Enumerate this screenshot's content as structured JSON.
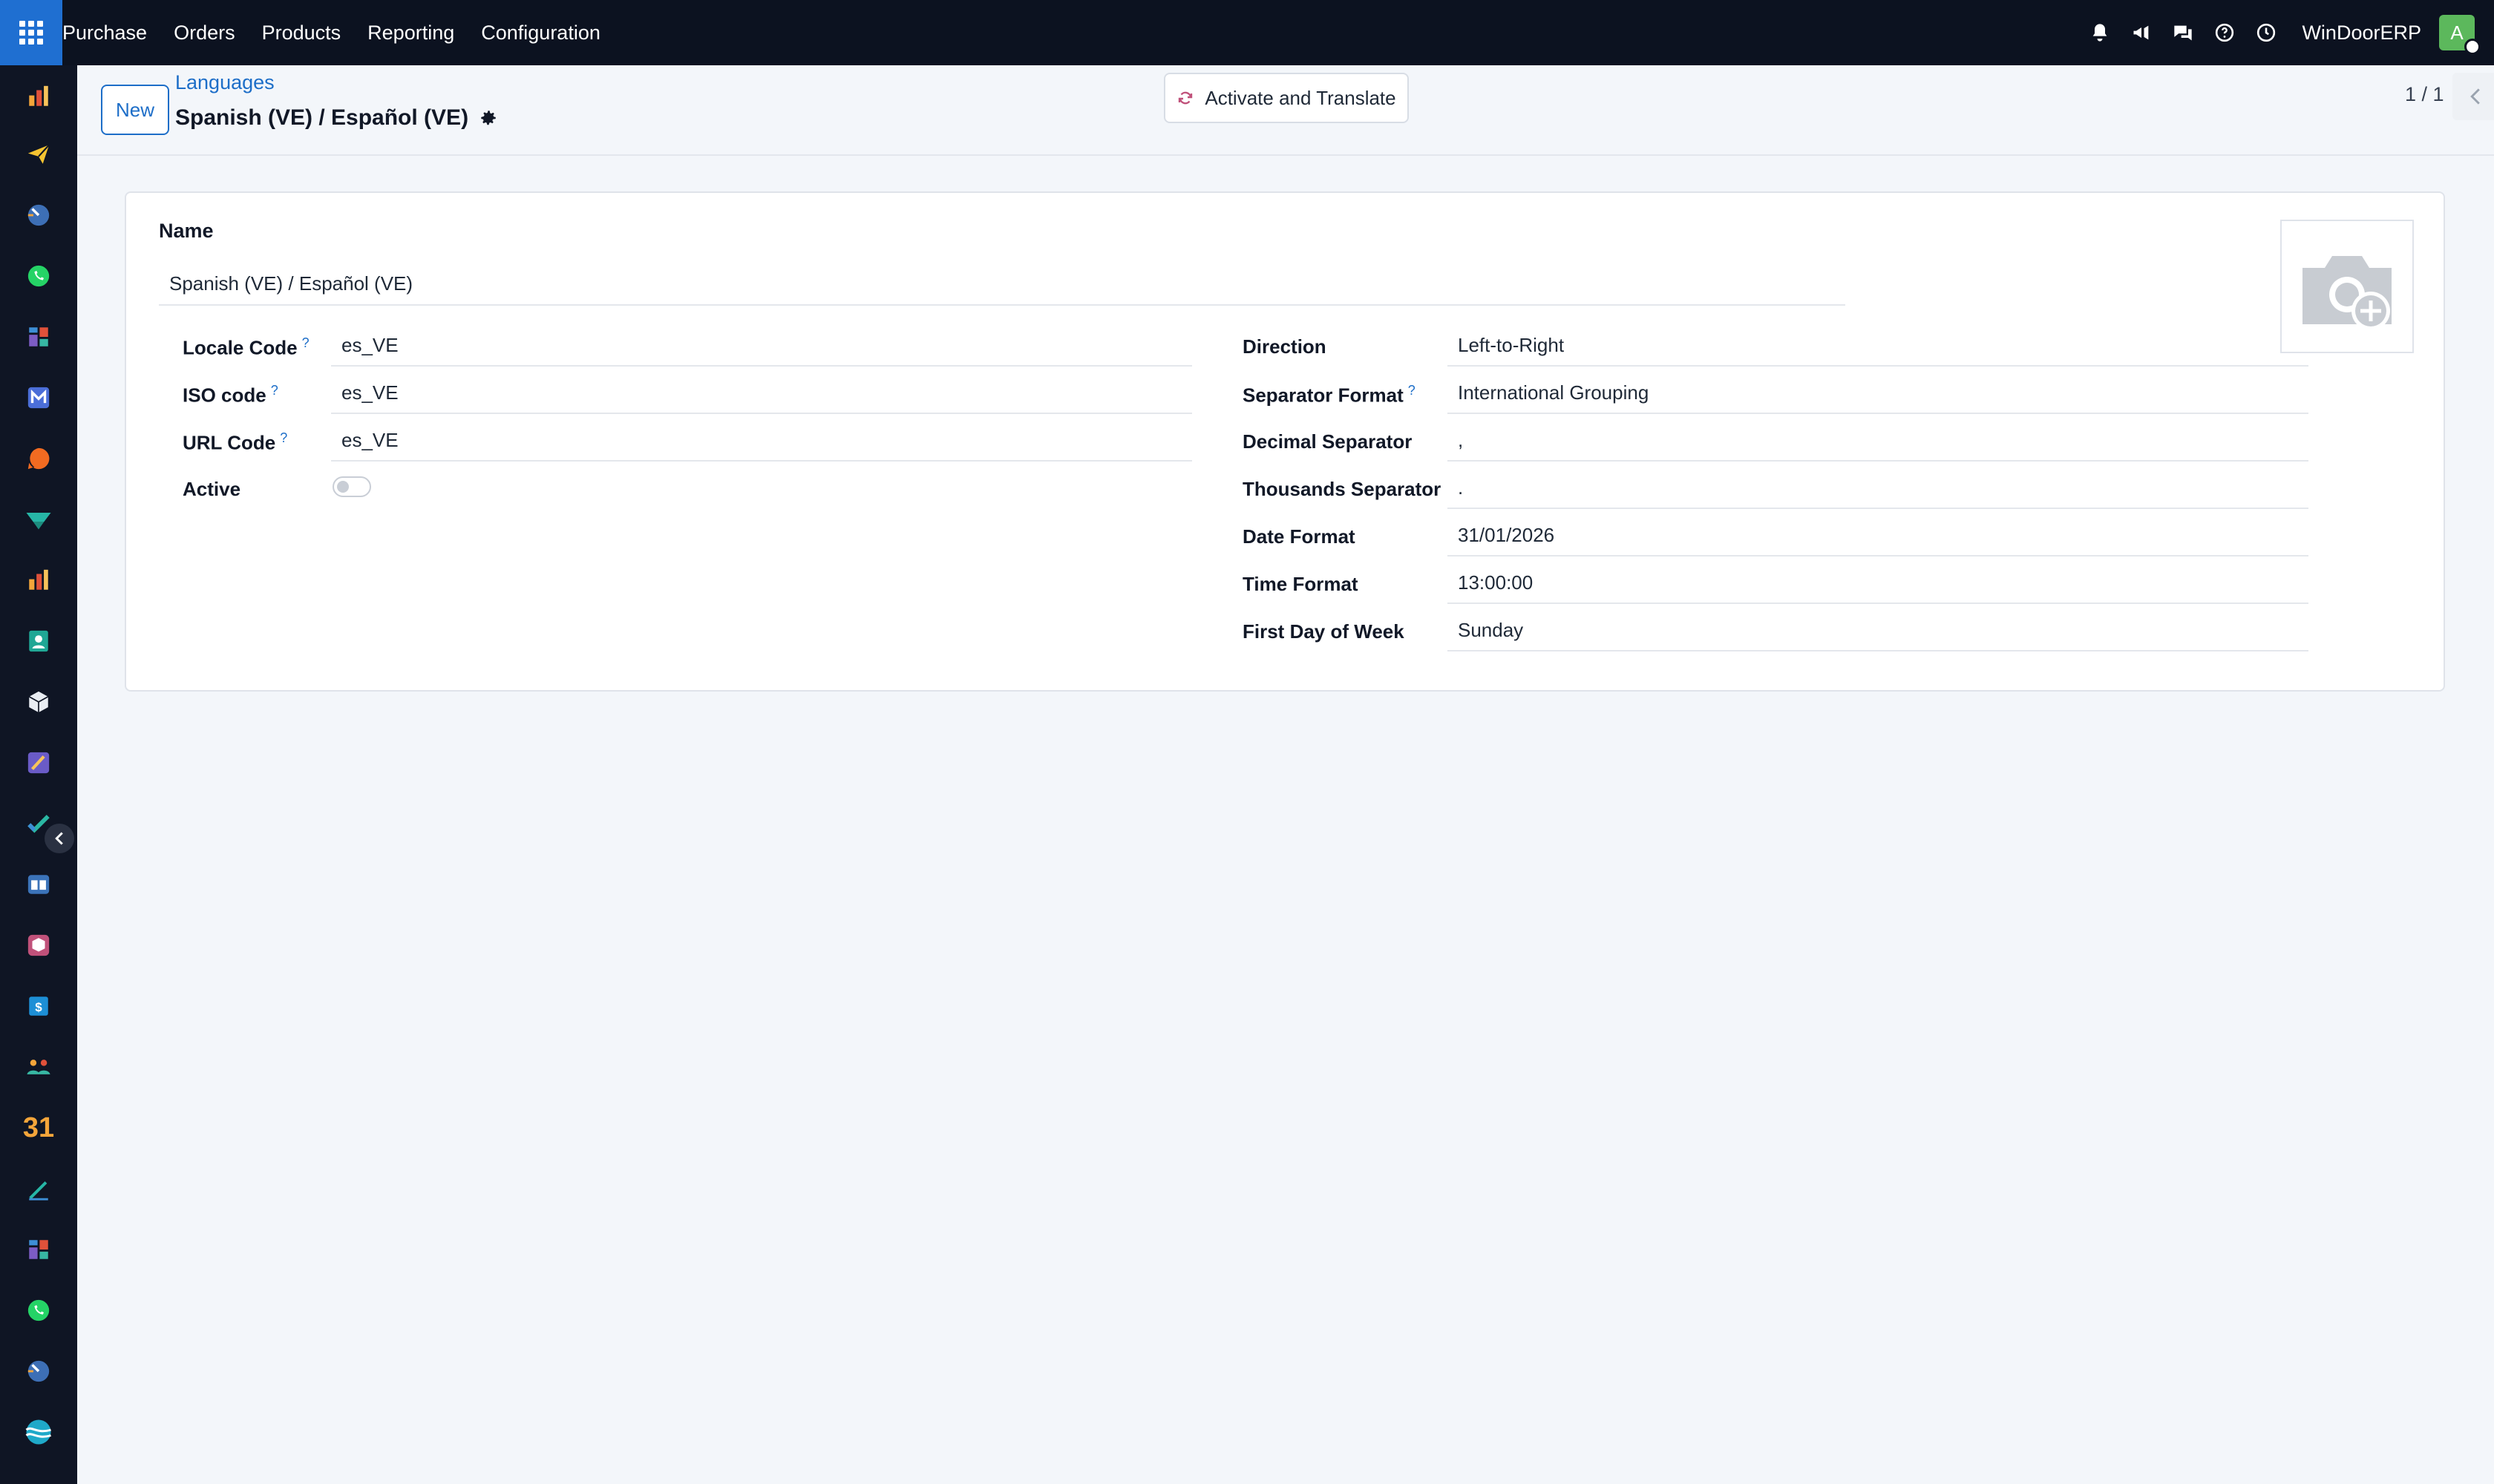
{
  "topbar": {
    "menu": [
      "Purchase",
      "Orders",
      "Products",
      "Reporting",
      "Configuration"
    ],
    "company": "WinDoorERP",
    "avatar_initial": "A",
    "icons": [
      "bell-icon",
      "megaphone-icon",
      "chat-icon",
      "help-icon",
      "clock-icon"
    ]
  },
  "sidebar": {
    "apps": [
      "sales-app-icon",
      "send-app-icon",
      "dashboard-app-icon",
      "whatsapp-app-icon",
      "grid-app-icon",
      "mail-app-icon",
      "discuss-app-icon",
      "vendor-app-icon",
      "reports-app-icon",
      "contacts-app-icon",
      "inventory-app-icon",
      "studio-app-icon",
      "todo-app-icon",
      "knowledge-app-icon",
      "package-app-icon",
      "invoice-app-icon",
      "team-app-icon",
      "calendar-app-icon",
      "sign-app-icon",
      "grid-app-icon-2",
      "whatsapp-app-icon-2",
      "dashboard-app-icon-2",
      "wave-app-icon"
    ],
    "calendar_label": "31"
  },
  "control": {
    "new_label": "New",
    "breadcrumb": "Languages",
    "title": "Spanish (VE) / Español (VE)",
    "activate_label": "Activate and Translate",
    "pager": "1 / 1"
  },
  "form": {
    "name_label": "Name",
    "name_value": "Spanish (VE) / Español (VE)",
    "left": [
      {
        "label": "Locale Code",
        "help": "?",
        "value": "es_VE"
      },
      {
        "label": "ISO code",
        "help": "?",
        "value": "es_VE"
      },
      {
        "label": "URL Code",
        "help": "?",
        "value": "es_VE"
      }
    ],
    "active_label": "Active",
    "active_value": false,
    "right": [
      {
        "label": "Direction",
        "help": "",
        "value": "Left-to-Right"
      },
      {
        "label": "Separator Format",
        "help": "?",
        "value": "International Grouping"
      },
      {
        "label": "Decimal Separator",
        "help": "",
        "value": ","
      },
      {
        "label": "Thousands Separator",
        "help": "",
        "value": "."
      },
      {
        "label": "Date Format",
        "help": "",
        "value": "31/01/2026"
      },
      {
        "label": "Time Format",
        "help": "",
        "value": "13:00:00"
      },
      {
        "label": "First Day of Week",
        "help": "",
        "value": "Sunday"
      }
    ]
  },
  "colors": {
    "topbar": "#0c1220",
    "sidebar": "#0f1524",
    "accent": "#1d6ec8",
    "background": "#f3f6fa"
  }
}
